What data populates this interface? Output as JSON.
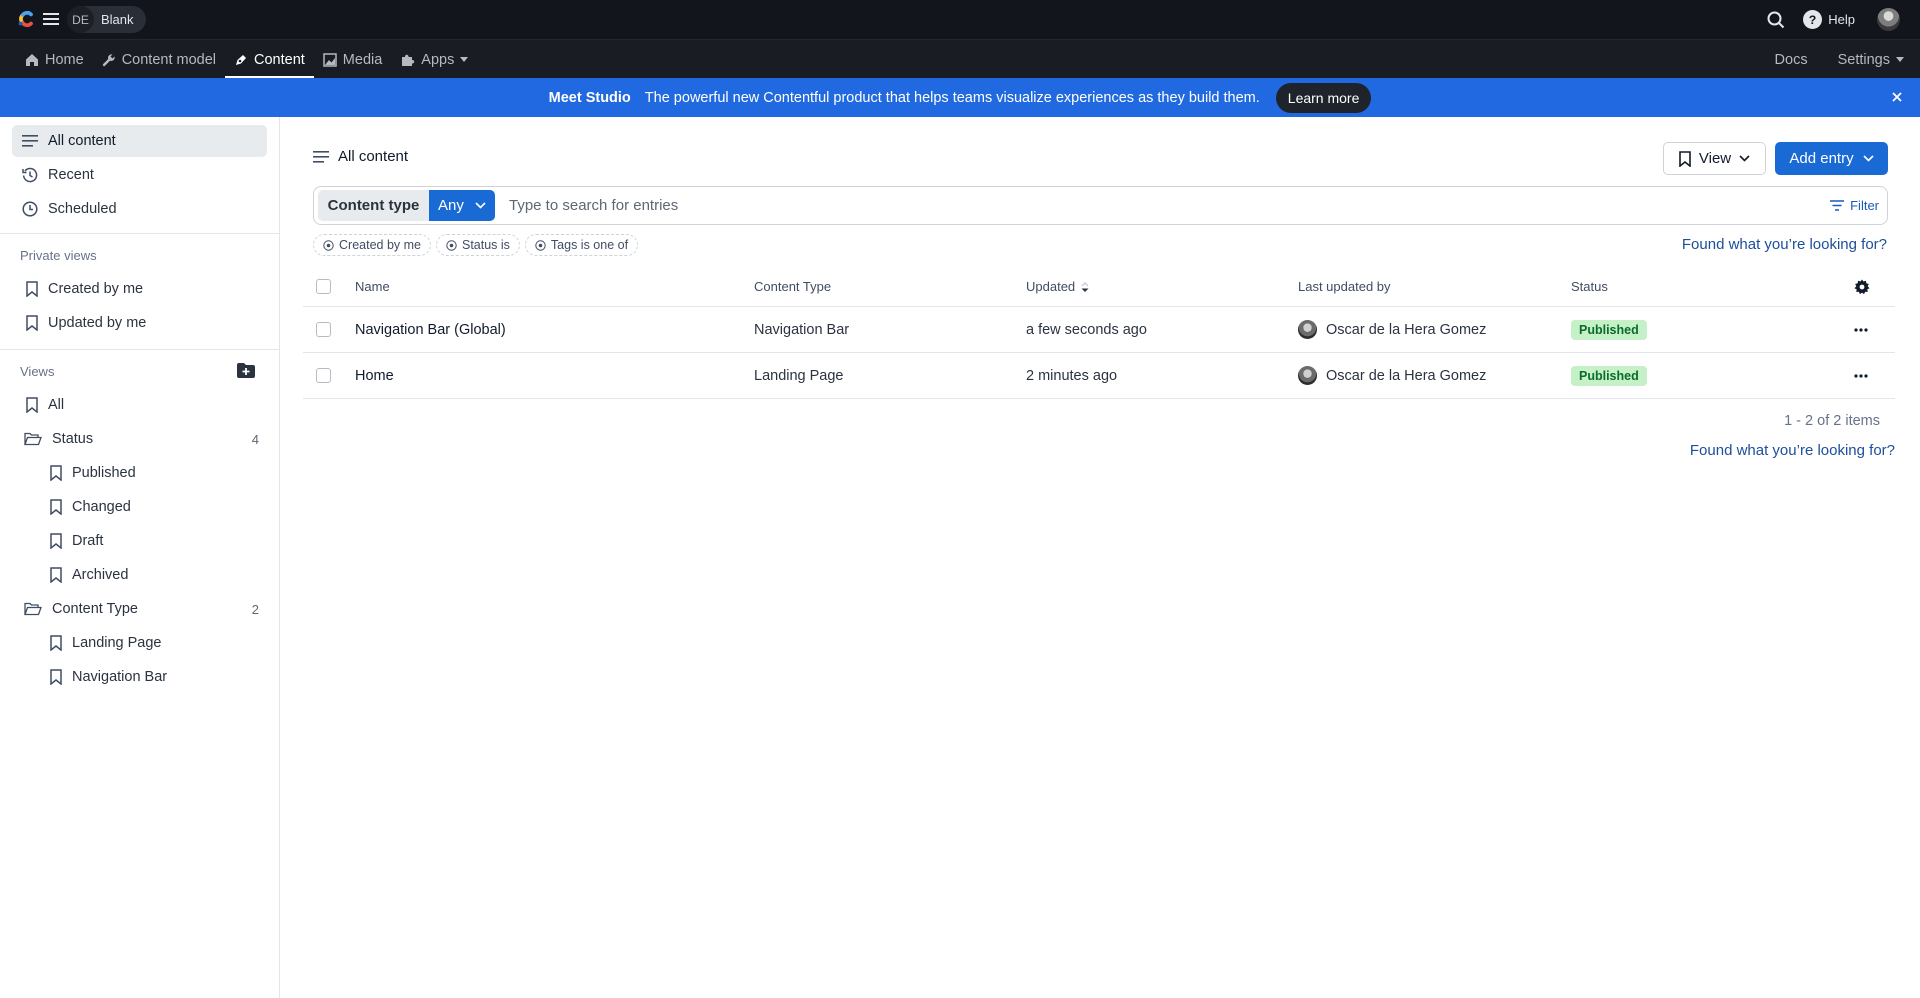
{
  "topbar": {
    "space_initials": "DE",
    "space_name": "Blank",
    "help_label": "Help"
  },
  "nav": {
    "items": [
      {
        "label": "Home",
        "icon": "home-icon"
      },
      {
        "label": "Content model",
        "icon": "wrench-icon"
      },
      {
        "label": "Content",
        "icon": "pen-icon",
        "active": true
      },
      {
        "label": "Media",
        "icon": "image-icon"
      },
      {
        "label": "Apps",
        "icon": "puzzle-icon",
        "dropdown": true
      }
    ],
    "docs_label": "Docs",
    "settings_label": "Settings"
  },
  "banner": {
    "title": "Meet Studio",
    "text": "The powerful new Contentful product that helps teams visualize experiences as they build them.",
    "cta": "Learn more"
  },
  "sidebar": {
    "top_items": [
      {
        "label": "All content",
        "icon": "list-icon",
        "active": true
      },
      {
        "label": "Recent",
        "icon": "history-icon"
      },
      {
        "label": "Scheduled",
        "icon": "clock-icon"
      }
    ],
    "private_views_heading": "Private views",
    "private_views": [
      {
        "label": "Created by me"
      },
      {
        "label": "Updated by me"
      }
    ],
    "views_heading": "Views",
    "views_all": "All",
    "folders": [
      {
        "label": "Status",
        "count": "4",
        "items": [
          "Published",
          "Changed",
          "Draft",
          "Archived"
        ]
      },
      {
        "label": "Content Type",
        "count": "2",
        "items": [
          "Landing Page",
          "Navigation Bar"
        ]
      }
    ]
  },
  "main": {
    "title": "All content",
    "view_button": "View",
    "add_entry_button": "Add entry",
    "search": {
      "content_type_label": "Content type",
      "content_type_value": "Any",
      "placeholder": "Type to search for entries",
      "filter_label": "Filter"
    },
    "filter_pills": [
      "Created by me",
      "Status is",
      "Tags is one of"
    ],
    "found_link": "Found what you’re looking for?",
    "table": {
      "columns": [
        "Name",
        "Content Type",
        "Updated",
        "Last updated by",
        "Status"
      ],
      "rows": [
        {
          "name": "Navigation Bar (Global)",
          "content_type": "Navigation Bar",
          "updated": "a few seconds ago",
          "updated_by": "Oscar de la Hera Gomez",
          "status": "Published"
        },
        {
          "name": "Home",
          "content_type": "Landing Page",
          "updated": "2 minutes ago",
          "updated_by": "Oscar de la Hera Gomez",
          "status": "Published"
        }
      ]
    },
    "pagination": "1 - 2 of 2 items",
    "found_link_bottom": "Found what you’re looking for?"
  },
  "colors": {
    "topbar_bg": "#12151b",
    "navbar_bg": "#191c22",
    "banner_bg": "#2169e0",
    "primary": "#1a6ad6",
    "link": "#1c4f99",
    "published_badge_bg": "#c5f0c8",
    "published_badge_text": "#0b6b2a"
  }
}
